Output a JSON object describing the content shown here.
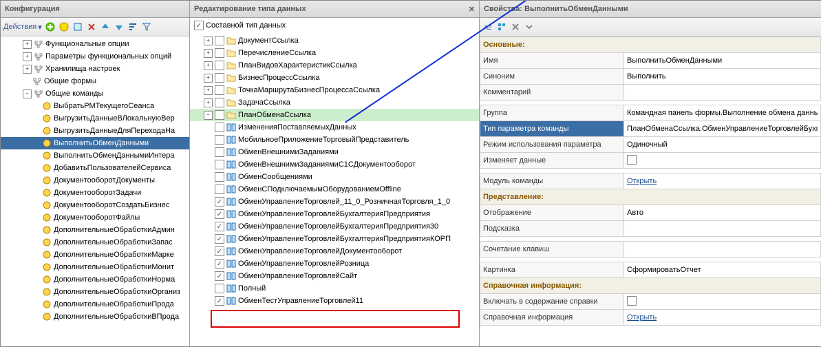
{
  "panels": {
    "left": {
      "title": "Конфигурация"
    },
    "mid": {
      "title": "Редактирование типа данных"
    },
    "right": {
      "title": "Свойства: ВыполнитьОбменДанными"
    }
  },
  "toolbar_left": {
    "actions": "Действия"
  },
  "mid": {
    "composite": "Составной тип данных"
  },
  "left_tree": [
    {
      "l": 2,
      "e": "+",
      "k": "func-opts",
      "t": "Функциональные опции"
    },
    {
      "l": 2,
      "e": "+",
      "k": "func-opts-params",
      "t": "Параметры функциональных опций"
    },
    {
      "l": 2,
      "e": "+",
      "k": "storage",
      "t": "Хранилища настроек"
    },
    {
      "l": 2,
      "e": " ",
      "k": "common-forms",
      "t": "Общие формы"
    },
    {
      "l": 2,
      "e": "-",
      "k": "common-commands",
      "t": "Общие команды"
    },
    {
      "l": 3,
      "k": "cmd1",
      "t": "ВыбратьРМТекущегоСеанса",
      "cmd": true
    },
    {
      "l": 3,
      "k": "cmd2",
      "t": "ВыгрузитьДанныеВЛокальнуюВер",
      "cmd": true
    },
    {
      "l": 3,
      "k": "cmd3",
      "t": "ВыгрузитьДанныеДляПереходаНа",
      "cmd": true
    },
    {
      "l": 3,
      "k": "cmd4",
      "t": "ВыполнитьОбменДанными",
      "cmd": true,
      "sel": true
    },
    {
      "l": 3,
      "k": "cmd5",
      "t": "ВыполнитьОбменДаннымиИнтера",
      "cmd": true
    },
    {
      "l": 3,
      "k": "cmd6",
      "t": "ДобавитьПользователейСервиса",
      "cmd": true
    },
    {
      "l": 3,
      "k": "cmd7",
      "t": "ДокументооборотДокументы",
      "cmd": true
    },
    {
      "l": 3,
      "k": "cmd8",
      "t": "ДокументооборотЗадачи",
      "cmd": true
    },
    {
      "l": 3,
      "k": "cmd9",
      "t": "ДокументооборотСоздатьБизнес",
      "cmd": true
    },
    {
      "l": 3,
      "k": "cmd10",
      "t": "ДокументооборотФайлы",
      "cmd": true
    },
    {
      "l": 3,
      "k": "cmd11",
      "t": "ДополнительныеОбработкиАдмин",
      "cmd": true
    },
    {
      "l": 3,
      "k": "cmd12",
      "t": "ДополнительныеОбработкиЗапас",
      "cmd": true
    },
    {
      "l": 3,
      "k": "cmd13",
      "t": "ДополнительныеОбработкиМарке",
      "cmd": true
    },
    {
      "l": 3,
      "k": "cmd14",
      "t": "ДополнительныеОбработкиМонит",
      "cmd": true
    },
    {
      "l": 3,
      "k": "cmd15",
      "t": "ДополнительныеОбработкиНорма",
      "cmd": true
    },
    {
      "l": 3,
      "k": "cmd16",
      "t": "ДополнительныеОбработкиОрганиз",
      "cmd": true
    },
    {
      "l": 3,
      "k": "cmd17",
      "t": "ДополнительныеОбработкиПрода",
      "cmd": true
    },
    {
      "l": 3,
      "k": "cmd18",
      "t": "ДополнительныеОбработкиВПрода",
      "cmd": true
    }
  ],
  "mid_tree": [
    {
      "l": 1,
      "e": "+",
      "f": true,
      "t": "ДокументСсылка"
    },
    {
      "l": 1,
      "e": "+",
      "f": true,
      "t": "ПеречислениеСсылка"
    },
    {
      "l": 1,
      "e": "+",
      "f": true,
      "t": "ПланВидовХарактеристикСсылка"
    },
    {
      "l": 1,
      "e": "+",
      "f": true,
      "t": "БизнесПроцессСсылка"
    },
    {
      "l": 1,
      "e": "+",
      "f": true,
      "t": "ТочкаМаршрутаБизнесПроцессаСсылка"
    },
    {
      "l": 1,
      "e": "+",
      "f": true,
      "t": "ЗадачаСсылка"
    },
    {
      "l": 1,
      "e": "-",
      "f": true,
      "t": "ПланОбменаСсылка",
      "selg": true
    },
    {
      "l": 2,
      "c": false,
      "x": true,
      "t": "ИзмененияПоставляемыхДанных"
    },
    {
      "l": 2,
      "c": false,
      "x": true,
      "t": "МобильноеПриложениеТорговыйПредставитель"
    },
    {
      "l": 2,
      "c": false,
      "x": true,
      "t": "ОбменВнешнимиЗаданиями"
    },
    {
      "l": 2,
      "c": false,
      "x": true,
      "t": "ОбменВнешнимиЗаданиямиС1СДокументооборот"
    },
    {
      "l": 2,
      "c": false,
      "x": true,
      "t": "ОбменСообщениями"
    },
    {
      "l": 2,
      "c": false,
      "x": true,
      "t": "ОбменСПодключаемымОборудованиемOffline"
    },
    {
      "l": 2,
      "c": true,
      "x": true,
      "t": "ОбменУправлениеТорговлей_11_0_РозничнаяТорговля_1_0"
    },
    {
      "l": 2,
      "c": true,
      "x": true,
      "t": "ОбменУправлениеТорговлейБухгалтерияПредприятия"
    },
    {
      "l": 2,
      "c": true,
      "x": true,
      "t": "ОбменУправлениеТорговлейБухгалтерияПредприятия30"
    },
    {
      "l": 2,
      "c": true,
      "x": true,
      "t": "ОбменУправлениеТорговлейБухгалтерияПредприятияКОРП"
    },
    {
      "l": 2,
      "c": true,
      "x": true,
      "t": "ОбменУправлениеТорговлейДокументооборот"
    },
    {
      "l": 2,
      "c": true,
      "x": true,
      "t": "ОбменУправлениеТорговлейРозница"
    },
    {
      "l": 2,
      "c": true,
      "x": true,
      "t": "ОбменУправлениеТорговлейСайт"
    },
    {
      "l": 2,
      "c": false,
      "x": true,
      "t": "Полный"
    },
    {
      "l": 2,
      "c": true,
      "x": true,
      "t": "ОбменТестУправлениеТорговлей11"
    }
  ],
  "props": {
    "sections": {
      "main": "Основные:",
      "repr": "Представление:",
      "ref": "Справочная информация:"
    },
    "rows": {
      "name": {
        "label": "Имя",
        "value": "ВыполнитьОбменДанными"
      },
      "syn": {
        "label": "Синоним",
        "value": "Выполнить"
      },
      "comment": {
        "label": "Комментарий",
        "value": ""
      },
      "group": {
        "label": "Группа",
        "value": "Командная панель формы.Выполнение обмена данными"
      },
      "ptype": {
        "label": "Тип параметра команды",
        "value": "ПланОбменаСсылка.ОбменУправлениеТорговлейБухг"
      },
      "pmode": {
        "label": "Режим использования параметра",
        "value": "Одиночный"
      },
      "changes": {
        "label": "Изменяет данные",
        "value": ""
      },
      "module": {
        "label": "Модуль команды",
        "link": "Открыть"
      },
      "display": {
        "label": "Отображение",
        "value": "Авто"
      },
      "hint": {
        "label": "Подсказка",
        "value": ""
      },
      "shortcut": {
        "label": "Сочетание клавиш",
        "value": ""
      },
      "pic": {
        "label": "Картинка",
        "value": "СформироватьОтчет"
      },
      "inhelp": {
        "label": "Включать в содержание справки",
        "value": ""
      },
      "helpinfo": {
        "label": "Справочная информация",
        "link": "Открыть"
      }
    }
  }
}
